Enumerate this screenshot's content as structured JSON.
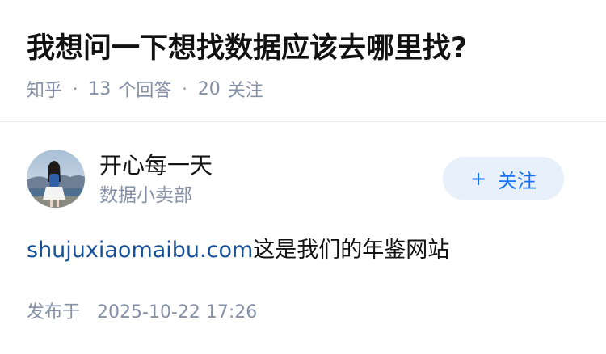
{
  "question": {
    "title": "我想问一下想找数据应该去哪里找?",
    "source": "知乎",
    "separator": "·",
    "answer_count": "13",
    "answer_count_label": "个回答",
    "follower_count": "20",
    "follower_count_label": "关注"
  },
  "answer": {
    "author": {
      "name": "开心每一天",
      "bio": "数据小卖部",
      "avatar_icon": "person-photo-avatar"
    },
    "follow_button": {
      "icon": "+",
      "label": "关注"
    },
    "content": {
      "link_text": "shujuxiaomaibu.com",
      "text": "这是我们的年鉴网站"
    },
    "time": {
      "label": "发布于",
      "value": "2025-10-22 17:26"
    }
  },
  "colors": {
    "link": "#175199",
    "accent": "#1772f6",
    "follow_bg": "#e8f1fb",
    "meta_gray": "#8590a6"
  }
}
